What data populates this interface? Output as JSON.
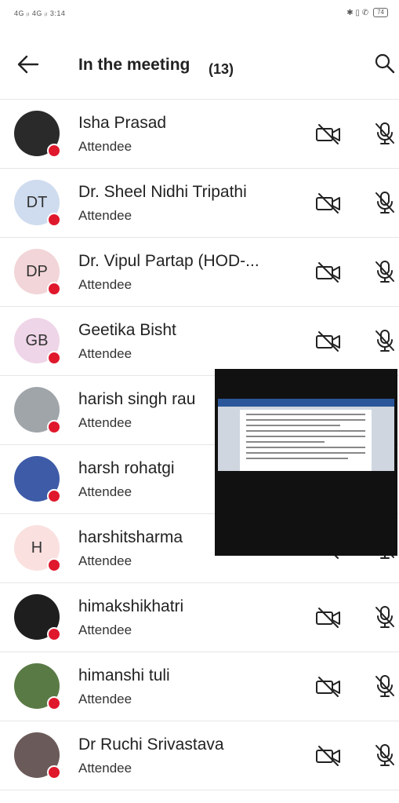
{
  "status": {
    "left": "4G ᵢₗ 4G ᵢₗ 3:14",
    "right": "✱ ▯ ✆",
    "battery": "74"
  },
  "header": {
    "title": "In the meeting",
    "count": "(13)"
  },
  "participants": [
    {
      "name": "Isha Prasad",
      "role": "Attendee",
      "initials": "",
      "avatar_color": "#2a2a2a"
    },
    {
      "name": "Dr. Sheel Nidhi Tripathi",
      "role": "Attendee",
      "initials": "DT",
      "avatar_color": "#cfdcef"
    },
    {
      "name": "Dr. Vipul Partap (HOD-...",
      "role": "Attendee",
      "initials": "DP",
      "avatar_color": "#f2d5d8"
    },
    {
      "name": "Geetika Bisht",
      "role": "Attendee",
      "initials": "GB",
      "avatar_color": "#efd5e8"
    },
    {
      "name": "harish singh rau",
      "role": "Attendee",
      "initials": "",
      "avatar_color": "#a0a5aa"
    },
    {
      "name": "harsh rohatgi",
      "role": "Attendee",
      "initials": "",
      "avatar_color": "#3e5ba8"
    },
    {
      "name": "harshitsharma",
      "role": "Attendee",
      "initials": "H",
      "avatar_color": "#fbe0e0"
    },
    {
      "name": "himakshikhatri",
      "role": "Attendee",
      "initials": "",
      "avatar_color": "#1e1e1e"
    },
    {
      "name": "himanshi tuli",
      "role": "Attendee",
      "initials": "",
      "avatar_color": "#5a7a45"
    },
    {
      "name": "Dr Ruchi Srivastava",
      "role": "Attendee",
      "initials": "",
      "avatar_color": "#6b5a5a"
    }
  ],
  "colors": {
    "presence_dot": "#e0182c",
    "divider": "#e6e6e6",
    "overlay": "#111111"
  }
}
